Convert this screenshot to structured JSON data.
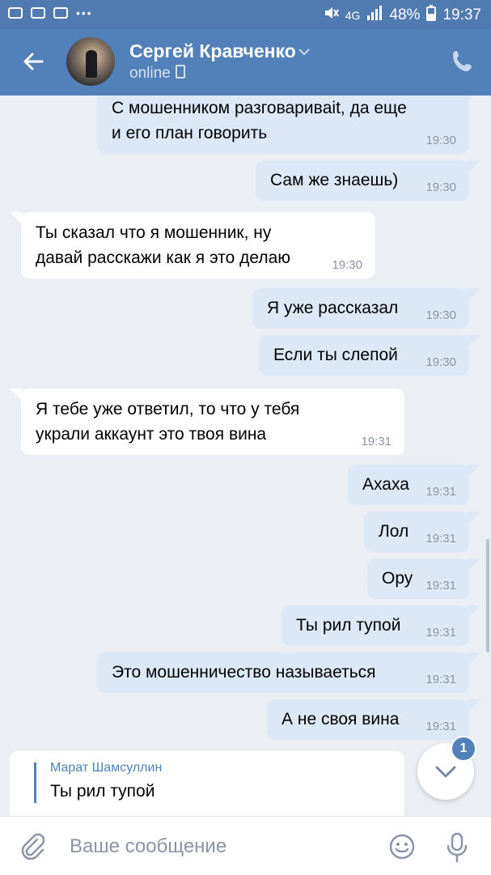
{
  "status_bar": {
    "network": "4G",
    "battery": "48%",
    "time": "19:37"
  },
  "header": {
    "contact_name": "Сергей Кравченко",
    "status": "online"
  },
  "messages": [
    {
      "text": "С мошенником разговаривait, да еще и его план говорить",
      "time": "19:30",
      "direction": "out"
    },
    {
      "text": "Сам же знаешь)",
      "time": "19:30",
      "direction": "out"
    },
    {
      "text": "Ты сказал что я мошенник, ну давай расскажи как я это делаю",
      "time": "19:30",
      "direction": "in"
    },
    {
      "text": "Я уже рассказал",
      "time": "19:30",
      "direction": "out"
    },
    {
      "text": "Если ты слепой",
      "time": "19:30",
      "direction": "out"
    },
    {
      "text": "Я тебе уже ответил, то что у тебя украли аккаунт это твоя вина",
      "time": "19:31",
      "direction": "in"
    },
    {
      "text": "Ахаха",
      "time": "19:31",
      "direction": "out"
    },
    {
      "text": "Лол",
      "time": "19:31",
      "direction": "out"
    },
    {
      "text": "Ору",
      "time": "19:31",
      "direction": "out"
    },
    {
      "text": "Ты рил тупой",
      "time": "19:31",
      "direction": "out"
    },
    {
      "text": "Это мошенничество называеться",
      "time": "19:31",
      "direction": "out"
    },
    {
      "text": "А не своя вина",
      "time": "19:31",
      "direction": "out"
    }
  ],
  "reply_preview": {
    "author": "Марат Шамсуллин",
    "text": "Ты рил тупой"
  },
  "unread_badge": "1",
  "composer": {
    "placeholder": "Ваше сообщение"
  },
  "colors": {
    "header": "#5181b8",
    "status_bar": "#4f7bb0",
    "outgoing_bubble": "#dde8f7",
    "incoming_bubble": "#ffffff",
    "background": "#ebeef3"
  }
}
